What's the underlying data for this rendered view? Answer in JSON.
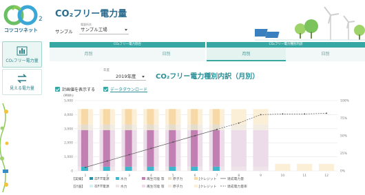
{
  "app": {
    "logo_text": "コツコツネット",
    "logo_sub": "2"
  },
  "sidebar": {
    "items": [
      {
        "label": "CO₂フリー電力量",
        "icon": "bar-chart-icon",
        "active": true
      },
      {
        "label": "見える電力量",
        "icon": "swap-arrows-icon",
        "active": false
      }
    ]
  },
  "header": {
    "title": "CO₂フリー電力量",
    "facility_caption": "電量所名",
    "sample_label": "サンプル",
    "facility_value": "サンプル工場"
  },
  "tabs": [
    {
      "heading": "CO₂フリー電力割合",
      "options": [
        {
          "label": "月別",
          "selected": false
        },
        {
          "label": "日別",
          "selected": false
        }
      ]
    },
    {
      "heading": "CO₂フリー電力種別内訳",
      "options": [
        {
          "label": "月別",
          "selected": true
        },
        {
          "label": "日別",
          "selected": false
        }
      ]
    }
  ],
  "controls": {
    "year_caption": "年度",
    "year_value": "2019年度",
    "chart_title": "CO₂フリー電力種別内訳（月別）",
    "show_plan_label": "計画値を表示する",
    "download_label": "データダウンロード"
  },
  "colors": {
    "accent": "#37a7a3",
    "title": "#2a6c8f"
  },
  "chart_data": {
    "type": "bar",
    "ylabel": "(MWh)",
    "ylim": [
      0,
      5000
    ],
    "y2lim": [
      0,
      100
    ],
    "y_ticks": [
      "5,000",
      "4,000",
      "3,000",
      "2,000",
      "1,000",
      "0"
    ],
    "y2_ticks": [
      "100%",
      "75%",
      "50%",
      "25%",
      "0%"
    ],
    "categories": [
      "1",
      "2",
      "3",
      "4",
      "5",
      "6",
      "7",
      "8",
      "9",
      "10",
      "11",
      "12"
    ],
    "plan_series": [
      {
        "name": "水力",
        "color": "#efe4ea",
        "values": [
          300,
          300,
          300,
          300,
          300,
          300,
          300,
          300,
          300,
          0,
          0,
          0
        ]
      },
      {
        "name": "再生可能 等",
        "color": "#ecdbe9",
        "values": [
          2600,
          2600,
          2600,
          2600,
          2600,
          2600,
          2600,
          2600,
          2600,
          0,
          0,
          0
        ]
      },
      {
        "name": "原子力",
        "color": "#f2ece3",
        "values": [
          400,
          400,
          400,
          400,
          400,
          400,
          400,
          400,
          400,
          0,
          0,
          0
        ]
      },
      {
        "name": "Jクレジット",
        "color": "#fbefd8",
        "values": [
          1100,
          1100,
          1100,
          1100,
          1100,
          1100,
          1100,
          1100,
          1100,
          500,
          500,
          500
        ]
      }
    ],
    "actual_series": [
      {
        "name": "水力",
        "color": "#3fb6c9",
        "values": [
          300,
          300,
          300,
          300,
          300,
          300,
          300,
          0,
          0,
          0,
          0,
          0
        ]
      },
      {
        "name": "再生可能 等",
        "color": "#c17fb2",
        "values": [
          2600,
          2600,
          2600,
          2600,
          2600,
          2600,
          2600,
          0,
          0,
          0,
          0,
          0
        ]
      },
      {
        "name": "原子力",
        "color": "#e6dccc",
        "values": [
          400,
          400,
          400,
          400,
          400,
          400,
          400,
          0,
          0,
          0,
          0,
          0
        ]
      },
      {
        "name": "Jクレジット",
        "color": "#f6d9a6",
        "values": [
          1100,
          1100,
          1100,
          1100,
          1100,
          1100,
          1100,
          0,
          0,
          0,
          0,
          0
        ]
      }
    ],
    "cumulative_actual_pct": [
      5,
      14,
      23,
      32,
      41,
      50,
      59,
      null,
      null,
      null,
      null,
      null
    ],
    "cumulative_plan_pct": [
      null,
      null,
      null,
      null,
      null,
      null,
      null,
      68,
      80,
      81,
      81,
      82
    ],
    "legend": {
      "row1_head": "【実績】",
      "row2_head": "【計画】",
      "items": [
        "卒FIT電源",
        "水力",
        "再生可能 等",
        "原子力",
        "Jクレジット"
      ],
      "line_actual": "達成電力量",
      "line_plan": "達成電力量率"
    }
  }
}
